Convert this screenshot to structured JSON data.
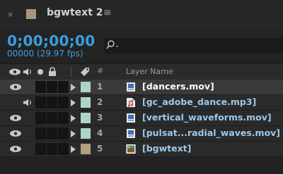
{
  "tab": {
    "close_glyph": "×",
    "title": "bgwtext 2",
    "menu_glyph": "≡",
    "swatch_color": "#a8967c"
  },
  "timecode": {
    "value": "0;00;00;00",
    "frames": "00000 (29.97 fps)",
    "color": "#3d9ee0"
  },
  "search": {
    "icon": "search-icon",
    "placeholder": ""
  },
  "columns": {
    "header_icons": [
      "eye-icon",
      "speaker-icon",
      "solo-dot-icon",
      "lock-icon",
      "label-tag-icon"
    ],
    "number": "#",
    "name": "Layer Name"
  },
  "layers": [
    {
      "num": "1",
      "name": "[dancers.mov]",
      "label_color": "#aed3c9",
      "file_icon": "footage-icon",
      "visible": true,
      "audio": false,
      "selected": true
    },
    {
      "num": "2",
      "name": "[gc_adobe_dance.mp3]",
      "label_color": "#aed3c9",
      "file_icon": "audio-file-icon",
      "visible": false,
      "audio": true,
      "selected": false
    },
    {
      "num": "3",
      "name": "[vertical_waveforms.mov]",
      "label_color": "#aed3c9",
      "file_icon": "footage-icon",
      "visible": true,
      "audio": false,
      "selected": false
    },
    {
      "num": "4",
      "name": "[pulsat...radial_waves.mov]",
      "label_color": "#aed3c9",
      "file_icon": "footage-icon",
      "visible": true,
      "audio": false,
      "selected": false
    },
    {
      "num": "5",
      "name": "[bgwtext]",
      "label_color": "#b4a07e",
      "file_icon": "composition-icon",
      "visible": true,
      "audio": false,
      "selected": false
    }
  ]
}
